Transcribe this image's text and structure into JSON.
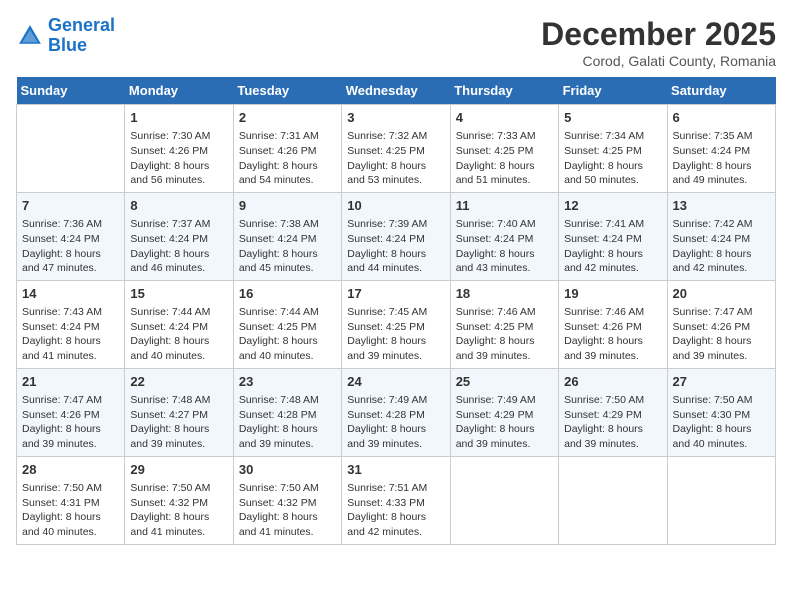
{
  "header": {
    "logo_line1": "General",
    "logo_line2": "Blue",
    "title": "December 2025",
    "subtitle": "Corod, Galati County, Romania"
  },
  "calendar": {
    "days_of_week": [
      "Sunday",
      "Monday",
      "Tuesday",
      "Wednesday",
      "Thursday",
      "Friday",
      "Saturday"
    ],
    "weeks": [
      [
        {
          "num": "",
          "info": ""
        },
        {
          "num": "1",
          "info": "Sunrise: 7:30 AM\nSunset: 4:26 PM\nDaylight: 8 hours\nand 56 minutes."
        },
        {
          "num": "2",
          "info": "Sunrise: 7:31 AM\nSunset: 4:26 PM\nDaylight: 8 hours\nand 54 minutes."
        },
        {
          "num": "3",
          "info": "Sunrise: 7:32 AM\nSunset: 4:25 PM\nDaylight: 8 hours\nand 53 minutes."
        },
        {
          "num": "4",
          "info": "Sunrise: 7:33 AM\nSunset: 4:25 PM\nDaylight: 8 hours\nand 51 minutes."
        },
        {
          "num": "5",
          "info": "Sunrise: 7:34 AM\nSunset: 4:25 PM\nDaylight: 8 hours\nand 50 minutes."
        },
        {
          "num": "6",
          "info": "Sunrise: 7:35 AM\nSunset: 4:24 PM\nDaylight: 8 hours\nand 49 minutes."
        }
      ],
      [
        {
          "num": "7",
          "info": "Sunrise: 7:36 AM\nSunset: 4:24 PM\nDaylight: 8 hours\nand 47 minutes."
        },
        {
          "num": "8",
          "info": "Sunrise: 7:37 AM\nSunset: 4:24 PM\nDaylight: 8 hours\nand 46 minutes."
        },
        {
          "num": "9",
          "info": "Sunrise: 7:38 AM\nSunset: 4:24 PM\nDaylight: 8 hours\nand 45 minutes."
        },
        {
          "num": "10",
          "info": "Sunrise: 7:39 AM\nSunset: 4:24 PM\nDaylight: 8 hours\nand 44 minutes."
        },
        {
          "num": "11",
          "info": "Sunrise: 7:40 AM\nSunset: 4:24 PM\nDaylight: 8 hours\nand 43 minutes."
        },
        {
          "num": "12",
          "info": "Sunrise: 7:41 AM\nSunset: 4:24 PM\nDaylight: 8 hours\nand 42 minutes."
        },
        {
          "num": "13",
          "info": "Sunrise: 7:42 AM\nSunset: 4:24 PM\nDaylight: 8 hours\nand 42 minutes."
        }
      ],
      [
        {
          "num": "14",
          "info": "Sunrise: 7:43 AM\nSunset: 4:24 PM\nDaylight: 8 hours\nand 41 minutes."
        },
        {
          "num": "15",
          "info": "Sunrise: 7:44 AM\nSunset: 4:24 PM\nDaylight: 8 hours\nand 40 minutes."
        },
        {
          "num": "16",
          "info": "Sunrise: 7:44 AM\nSunset: 4:25 PM\nDaylight: 8 hours\nand 40 minutes."
        },
        {
          "num": "17",
          "info": "Sunrise: 7:45 AM\nSunset: 4:25 PM\nDaylight: 8 hours\nand 39 minutes."
        },
        {
          "num": "18",
          "info": "Sunrise: 7:46 AM\nSunset: 4:25 PM\nDaylight: 8 hours\nand 39 minutes."
        },
        {
          "num": "19",
          "info": "Sunrise: 7:46 AM\nSunset: 4:26 PM\nDaylight: 8 hours\nand 39 minutes."
        },
        {
          "num": "20",
          "info": "Sunrise: 7:47 AM\nSunset: 4:26 PM\nDaylight: 8 hours\nand 39 minutes."
        }
      ],
      [
        {
          "num": "21",
          "info": "Sunrise: 7:47 AM\nSunset: 4:26 PM\nDaylight: 8 hours\nand 39 minutes."
        },
        {
          "num": "22",
          "info": "Sunrise: 7:48 AM\nSunset: 4:27 PM\nDaylight: 8 hours\nand 39 minutes."
        },
        {
          "num": "23",
          "info": "Sunrise: 7:48 AM\nSunset: 4:28 PM\nDaylight: 8 hours\nand 39 minutes."
        },
        {
          "num": "24",
          "info": "Sunrise: 7:49 AM\nSunset: 4:28 PM\nDaylight: 8 hours\nand 39 minutes."
        },
        {
          "num": "25",
          "info": "Sunrise: 7:49 AM\nSunset: 4:29 PM\nDaylight: 8 hours\nand 39 minutes."
        },
        {
          "num": "26",
          "info": "Sunrise: 7:50 AM\nSunset: 4:29 PM\nDaylight: 8 hours\nand 39 minutes."
        },
        {
          "num": "27",
          "info": "Sunrise: 7:50 AM\nSunset: 4:30 PM\nDaylight: 8 hours\nand 40 minutes."
        }
      ],
      [
        {
          "num": "28",
          "info": "Sunrise: 7:50 AM\nSunset: 4:31 PM\nDaylight: 8 hours\nand 40 minutes."
        },
        {
          "num": "29",
          "info": "Sunrise: 7:50 AM\nSunset: 4:32 PM\nDaylight: 8 hours\nand 41 minutes."
        },
        {
          "num": "30",
          "info": "Sunrise: 7:50 AM\nSunset: 4:32 PM\nDaylight: 8 hours\nand 41 minutes."
        },
        {
          "num": "31",
          "info": "Sunrise: 7:51 AM\nSunset: 4:33 PM\nDaylight: 8 hours\nand 42 minutes."
        },
        {
          "num": "",
          "info": ""
        },
        {
          "num": "",
          "info": ""
        },
        {
          "num": "",
          "info": ""
        }
      ]
    ]
  }
}
